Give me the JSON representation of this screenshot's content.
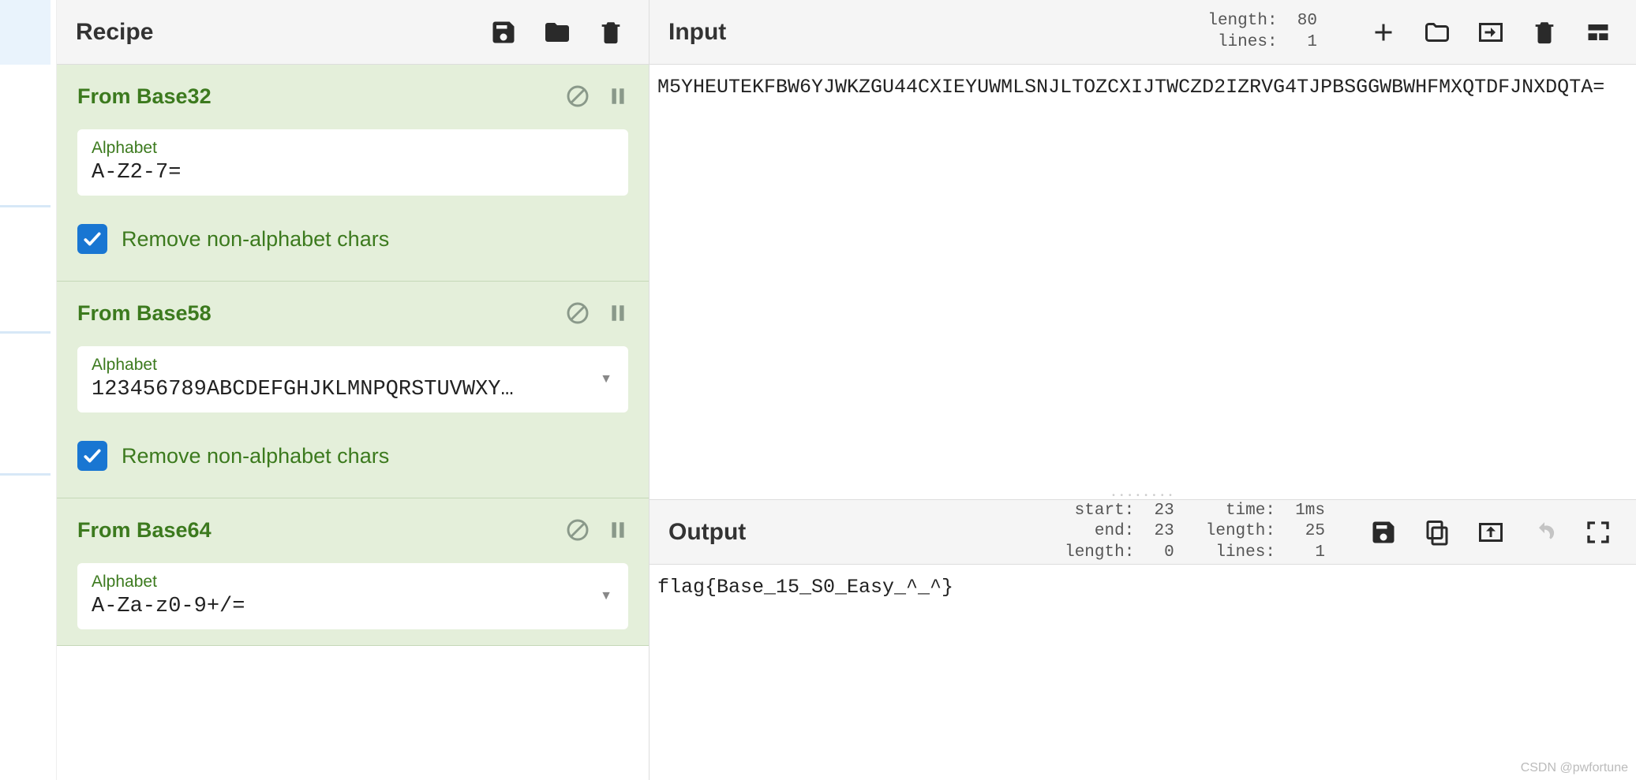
{
  "recipe": {
    "title": "Recipe",
    "operations": [
      {
        "name": "From Base32",
        "alphabet_label": "Alphabet",
        "alphabet_value": "A-Z2-7=",
        "has_dropdown": false,
        "checkbox_label": "Remove non-alphabet chars",
        "checkbox_checked": true
      },
      {
        "name": "From Base58",
        "alphabet_label": "Alphabet",
        "alphabet_value": "123456789ABCDEFGHJKLMNPQRSTUVWXY…",
        "has_dropdown": true,
        "checkbox_label": "Remove non-alphabet chars",
        "checkbox_checked": true
      },
      {
        "name": "From Base64",
        "alphabet_label": "Alphabet",
        "alphabet_value": "A-Za-z0-9+/=",
        "has_dropdown": true,
        "checkbox_label": "",
        "checkbox_checked": false
      }
    ]
  },
  "input": {
    "title": "Input",
    "stats": {
      "length_label": "length:",
      "length_value": "80",
      "lines_label": "lines:",
      "lines_value": "1"
    },
    "text": "M5YHEUTEKFBW6YJWKZGU44CXIEYUWMLSNJLTOZCXIJTWCZD2IZRVG4TJPBSGGWBWHFMXQTDFJNXDQTA="
  },
  "output": {
    "title": "Output",
    "stats": {
      "start_label": "start:",
      "start_value": "23",
      "end_label": "end:",
      "end_value": "23",
      "length_label_left": "length:",
      "length_value_left": "0",
      "time_label": "time:",
      "time_value": "1ms",
      "length_label": "length:",
      "length_value": "25",
      "lines_label": "lines:",
      "lines_value": "1"
    },
    "text": "flag{Base_15_S0_Easy_^_^}"
  },
  "watermark": "CSDN @pwfortune"
}
